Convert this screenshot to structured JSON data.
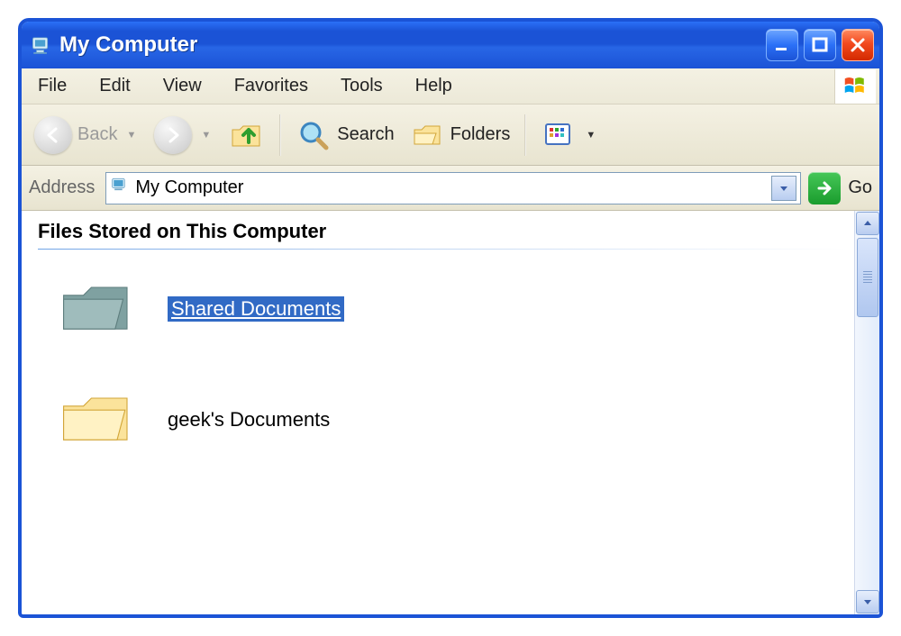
{
  "title": "My Computer",
  "menu": {
    "items": [
      "File",
      "Edit",
      "View",
      "Favorites",
      "Tools",
      "Help"
    ]
  },
  "toolbar": {
    "back_label": "Back",
    "search_label": "Search",
    "folders_label": "Folders"
  },
  "address": {
    "label": "Address",
    "value": "My Computer",
    "go_label": "Go"
  },
  "section_header": "Files Stored on This Computer",
  "items": [
    {
      "label": "Shared Documents",
      "selected": true,
      "icon": "shared-folder"
    },
    {
      "label": "geek's Documents",
      "selected": false,
      "icon": "folder"
    }
  ]
}
